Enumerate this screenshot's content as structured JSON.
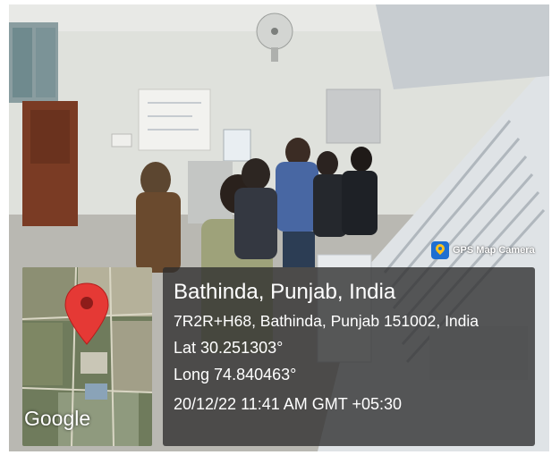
{
  "watermark": {
    "app_name": "GPS Map Camera",
    "title": "Bathinda, Punjab, India",
    "address": "7R2R+H68, Bathinda, Punjab 151002, India",
    "latitude": "Lat 30.251303°",
    "longitude": "Long 74.840463°",
    "timestamp": "20/12/22 11:41 AM GMT +05:30"
  },
  "map": {
    "provider_label": "Google",
    "pin_color": "#e53935"
  },
  "colors": {
    "panel": "#2d2d2d",
    "text": "#ffffff",
    "app_icon": "#1f6fd1"
  }
}
